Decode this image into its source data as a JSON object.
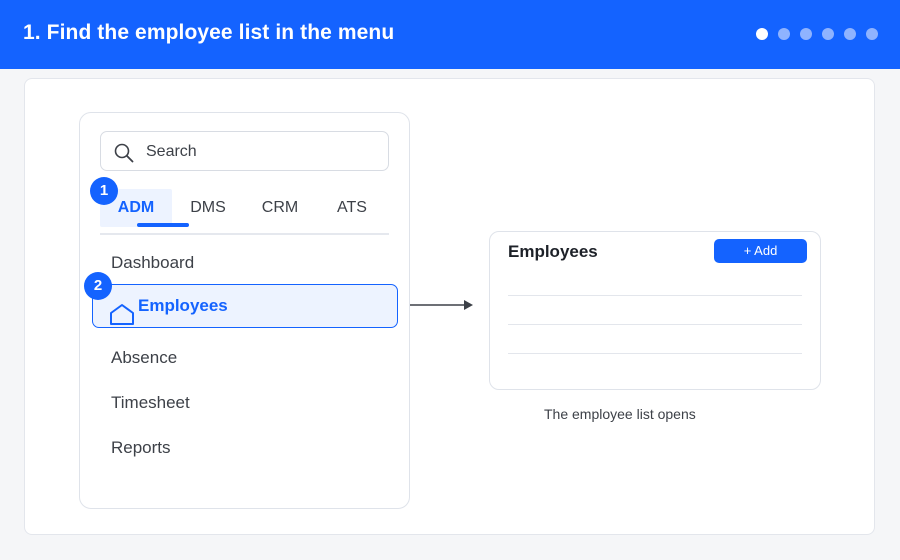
{
  "header": {
    "title": "1. Find the employee list in the menu",
    "step_count": 6,
    "active_step": 1,
    "colors": {
      "brand": "#1463ff",
      "dot_active": "#ffffff",
      "dot_inactive": "#8fb3ff"
    }
  },
  "menu": {
    "search": {
      "icon": "search-icon",
      "placeholder": "Search"
    },
    "tabs": [
      {
        "label": "ADM",
        "active": true
      },
      {
        "label": "DMS",
        "active": false
      },
      {
        "label": "CRM",
        "active": false
      },
      {
        "label": "ATS",
        "active": false
      }
    ],
    "items": [
      {
        "label": "Dashboard",
        "selected": false
      },
      {
        "label": "Employees",
        "selected": true,
        "icon": "home-icon"
      },
      {
        "label": "Absence",
        "selected": false
      },
      {
        "label": "Timesheet",
        "selected": false
      },
      {
        "label": "Reports",
        "selected": false
      }
    ]
  },
  "callouts": {
    "badge1": "1",
    "badge2": "2"
  },
  "result": {
    "title": "Employees",
    "add_label": "+ Add",
    "caption": "The employee list opens"
  }
}
